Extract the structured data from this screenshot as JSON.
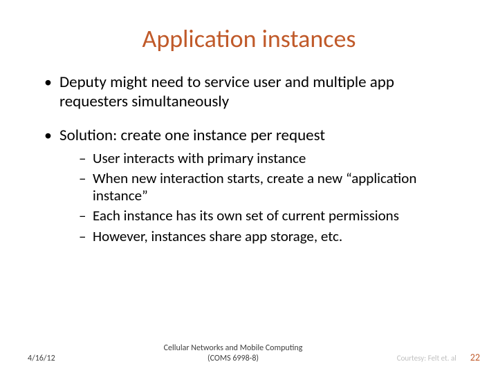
{
  "title": "Application instances",
  "bullets": {
    "b1": "Deputy might need to service user and multiple app requesters simultaneously",
    "b2": "Solution: create one instance per request",
    "sub": {
      "s1": "User interacts with primary instance",
      "s2": "When new interaction starts, create a new “application instance”",
      "s3": "Each instance has its own set of current permissions",
      "s4": "However, instances share app storage, etc."
    }
  },
  "footer": {
    "date": "4/16/12",
    "center_line1": "Cellular Networks and Mobile Computing",
    "center_line2": "(COMS 6998-8)",
    "courtesy": "Courtesy: Felt et. al",
    "page": "22"
  }
}
